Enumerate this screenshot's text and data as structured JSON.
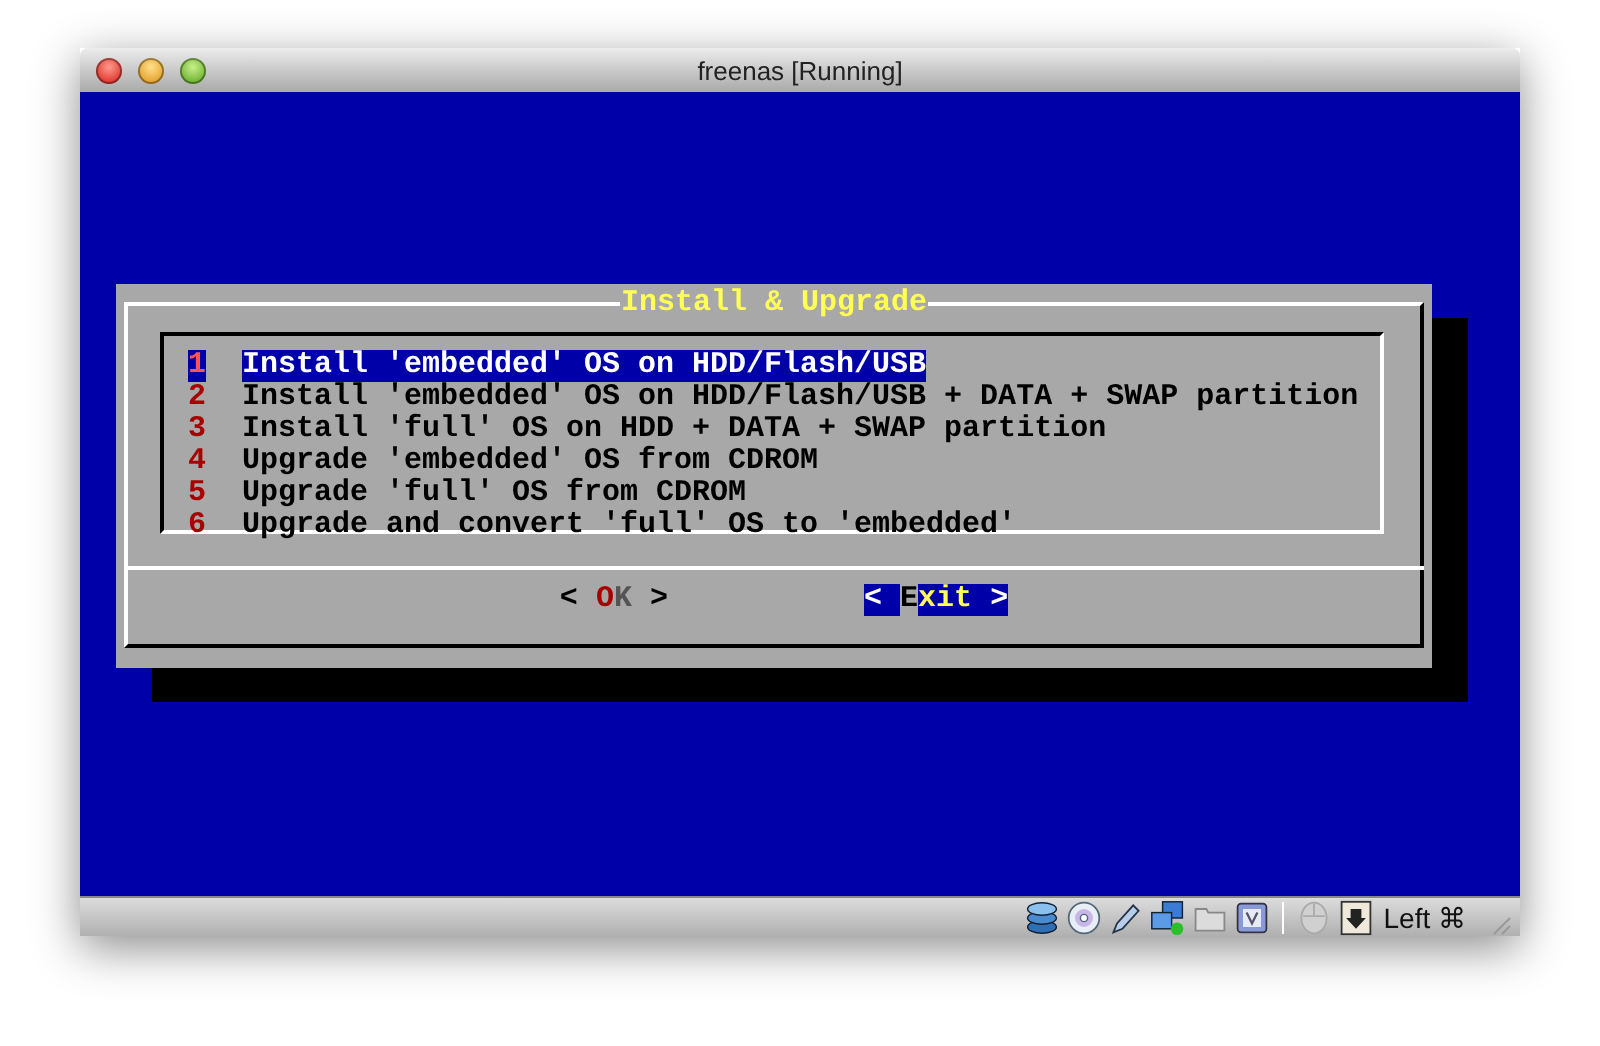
{
  "window": {
    "title": "freenas [Running]"
  },
  "dialog": {
    "title": "Install & Upgrade",
    "items": [
      {
        "key": "1",
        "label": "Install 'embedded' OS on HDD/Flash/USB",
        "selected": true
      },
      {
        "key": "2",
        "label": "Install 'embedded' OS on HDD/Flash/USB + DATA + SWAP partition",
        "selected": false
      },
      {
        "key": "3",
        "label": "Install 'full' OS on HDD + DATA + SWAP partition",
        "selected": false
      },
      {
        "key": "4",
        "label": "Upgrade 'embedded' OS from CDROM",
        "selected": false
      },
      {
        "key": "5",
        "label": "Upgrade 'full' OS from CDROM",
        "selected": false
      },
      {
        "key": "6",
        "label": "Upgrade and convert 'full' OS to 'embedded'",
        "selected": false
      }
    ],
    "buttons": [
      {
        "open": "<",
        "label": "OK",
        "close": ">",
        "selected": false
      },
      {
        "open": "<",
        "label": "Exit",
        "close": ">",
        "selected": true
      }
    ]
  },
  "status_bar": {
    "host_key": "Left ⌘"
  }
}
